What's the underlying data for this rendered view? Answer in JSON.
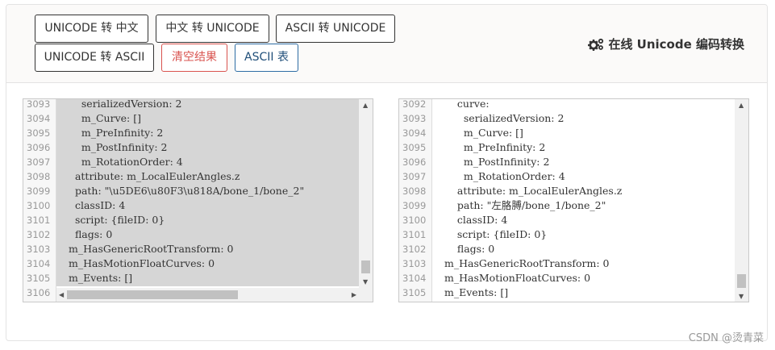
{
  "toolbar": {
    "unicode_to_chinese": "UNICODE 转 中文",
    "chinese_to_unicode": "中文 转 UNICODE",
    "ascii_to_unicode": "ASCII 转 UNICODE",
    "unicode_to_ascii": "UNICODE 转 ASCII",
    "clear_result": "清空结果",
    "ascii_table": "ASCII 表"
  },
  "app_title": "在线 Unicode 编码转换",
  "left_editor": {
    "line_numbers": [
      "3093",
      "3094",
      "3095",
      "3096",
      "3097",
      "3098",
      "3099",
      "3100",
      "3101",
      "3102",
      "3103",
      "3104",
      "3105",
      "3106"
    ],
    "lines": [
      "    serializedVersion: 2",
      "    m_Curve: []",
      "    m_PreInfinity: 2",
      "    m_PostInfinity: 2",
      "    m_RotationOrder: 4",
      "  attribute: m_LocalEulerAngles.z",
      "  path: \"\\u5DE6\\u80F3\\u818A/bone_1/bone_2\"",
      "  classID: 4",
      "  script: {fileID: 0}",
      "  flags: 0",
      "m_HasGenericRootTransform: 0",
      "m_HasMotionFloatCurves: 0",
      "m_Events: []",
      ""
    ]
  },
  "right_editor": {
    "line_numbers": [
      "3092",
      "3093",
      "3094",
      "3095",
      "3096",
      "3097",
      "3098",
      "3099",
      "3100",
      "3101",
      "3102",
      "3103",
      "3104",
      "3105"
    ],
    "lines": [
      "    curve:",
      "      serializedVersion: 2",
      "      m_Curve: []",
      "      m_PreInfinity: 2",
      "      m_PostInfinity: 2",
      "      m_RotationOrder: 4",
      "    attribute: m_LocalEulerAngles.z",
      "    path: \"左胳膊/bone_1/bone_2\"",
      "    classID: 4",
      "    script: {fileID: 0}",
      "    flags: 0",
      "m_HasGenericRootTransform: 0",
      "m_HasMotionFloatCurves: 0",
      "m_Events: []"
    ]
  },
  "watermark": "CSDN @烫青菜",
  "icons": {
    "title_icon": "gears-icon"
  }
}
